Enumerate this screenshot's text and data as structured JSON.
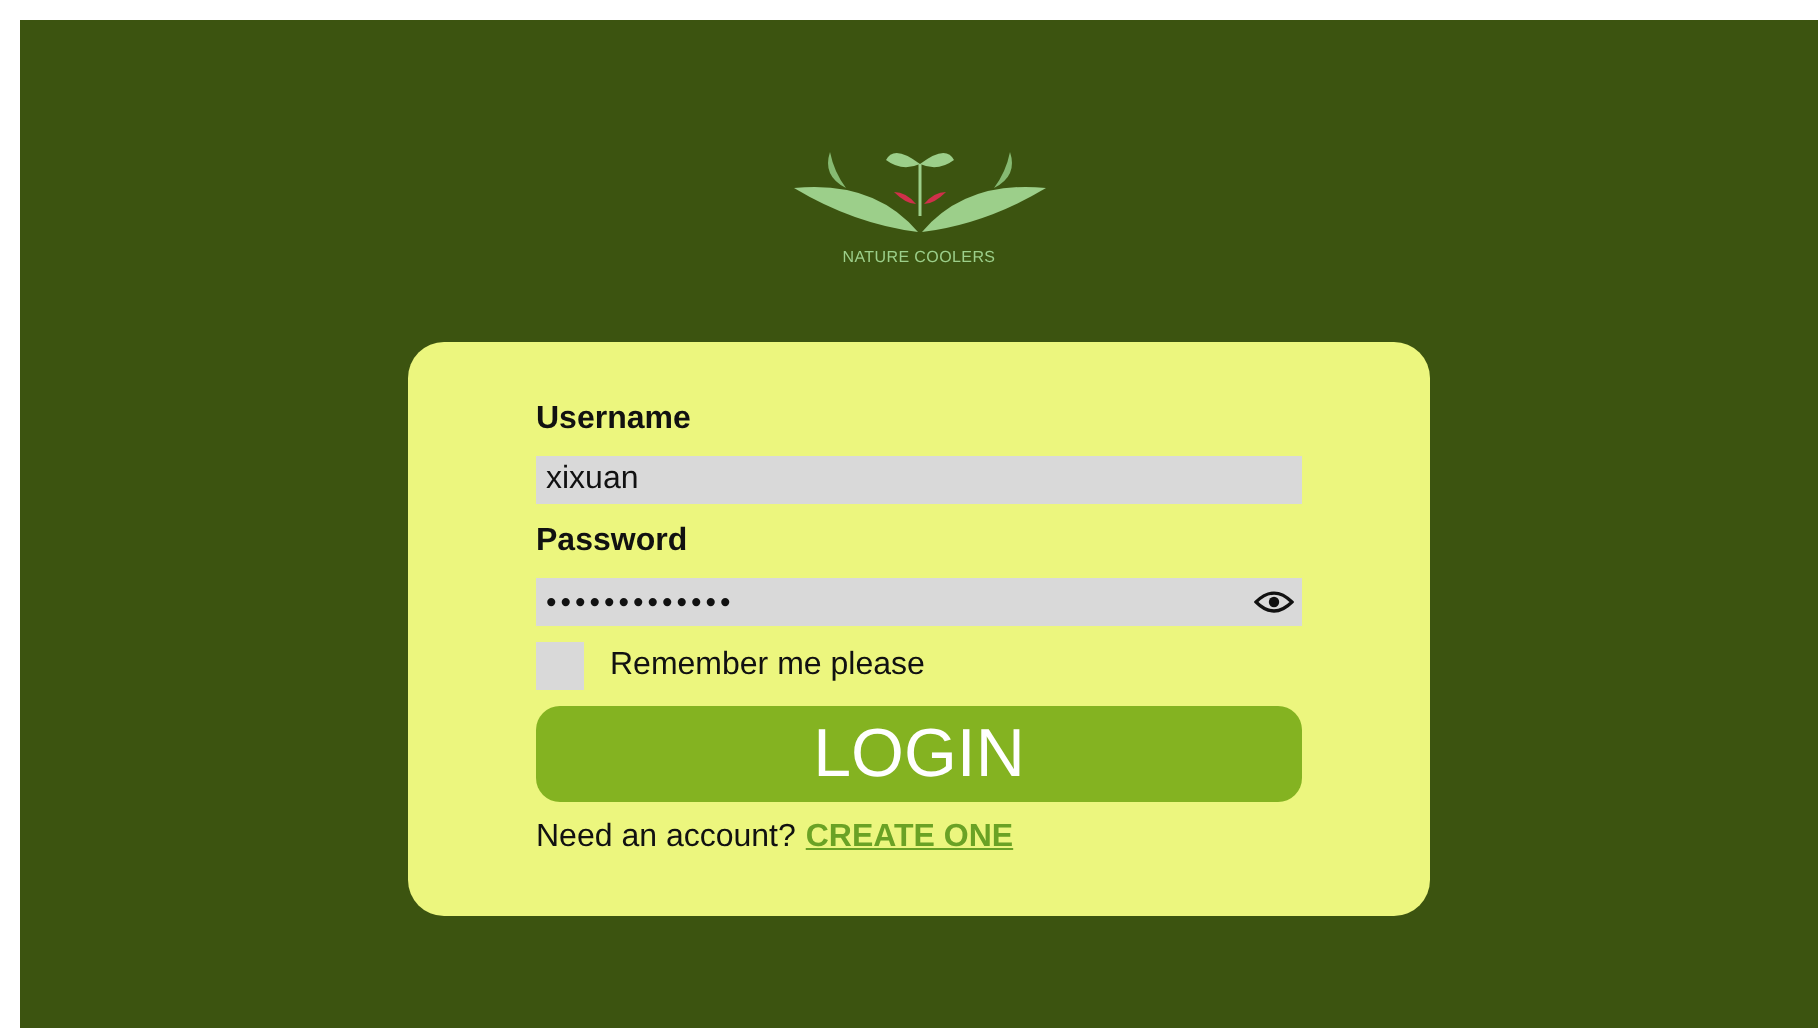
{
  "logo": {
    "name": "NATURE COOLERS"
  },
  "form": {
    "username": {
      "label": "Username",
      "value": "xixuan"
    },
    "password": {
      "label": "Password",
      "value": "•••••••••••••"
    },
    "remember": {
      "label": "Remember me please",
      "checked": false
    },
    "login_button": "LOGIN",
    "signup": {
      "prompt": "Need an account?",
      "link": "CREATE ONE"
    }
  }
}
